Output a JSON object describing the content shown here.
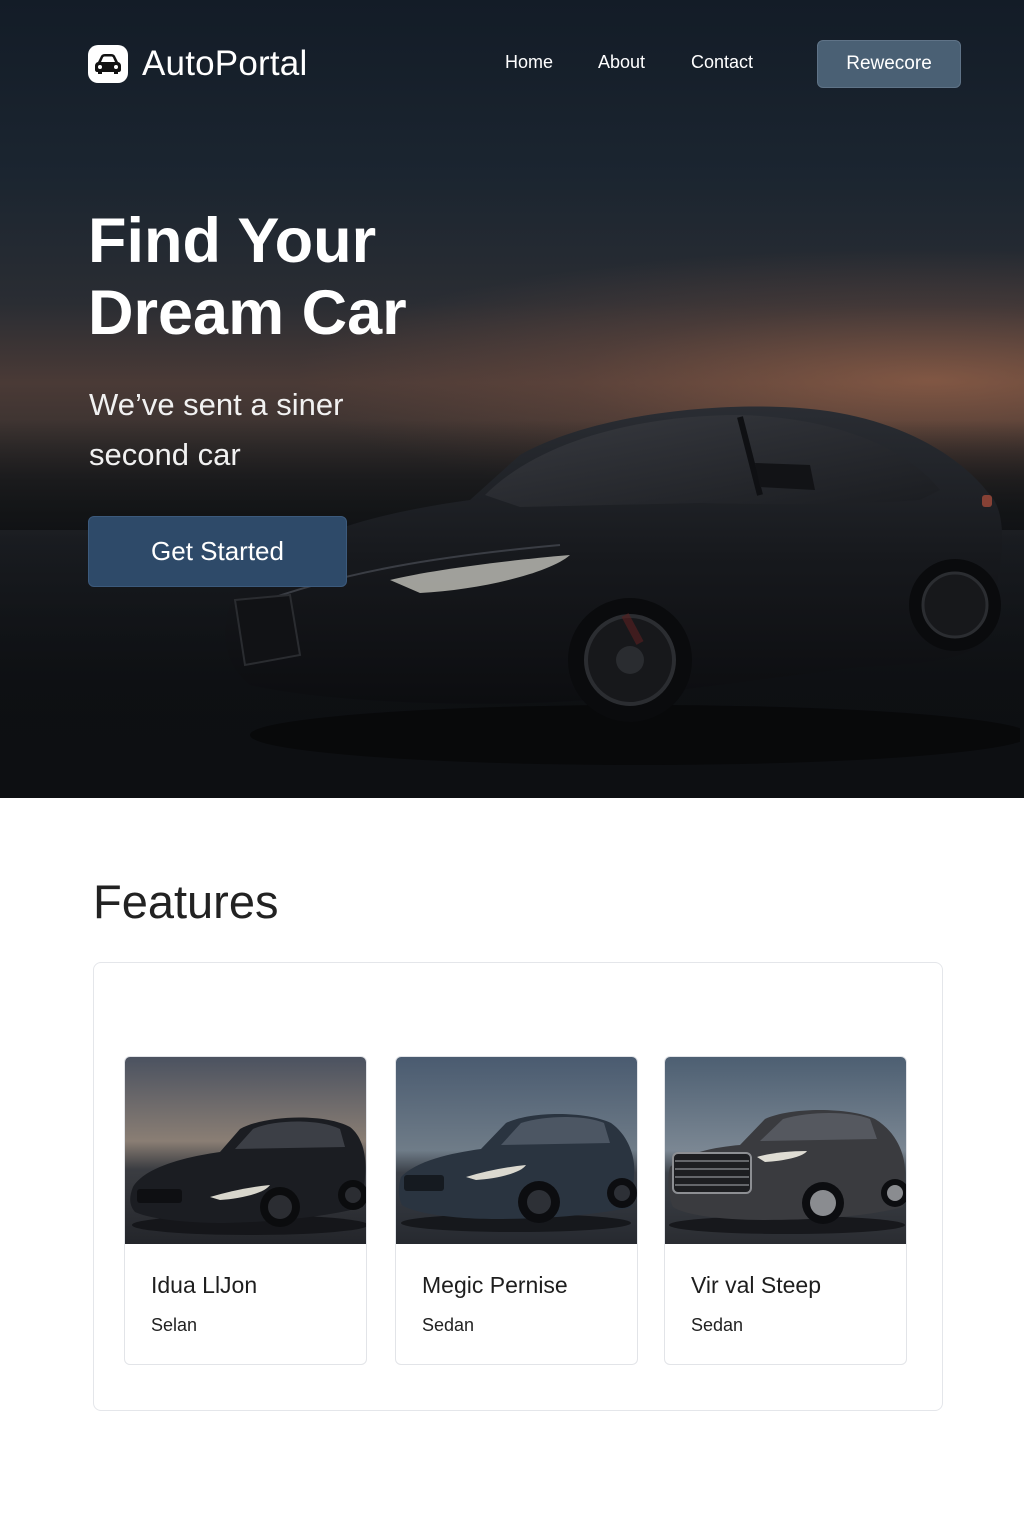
{
  "header": {
    "brand": "AutoPortal",
    "logo_icon": "car-icon",
    "nav": [
      "Home",
      "About",
      "Contact"
    ],
    "cta_label": "Rewecore"
  },
  "hero": {
    "title_line1": "Find Your",
    "title_line2": "Dream Car",
    "subtitle": "We’ve sent a siner second car",
    "button_label": "Get Started"
  },
  "features": {
    "title": "Features",
    "cards": [
      {
        "name": "Idua LlJon",
        "type": "Selan"
      },
      {
        "name": "Megic Pernise",
        "type": "Sedan"
      },
      {
        "name": "Vir val Steep",
        "type": "Sedan"
      }
    ]
  },
  "colors": {
    "hero_dark": "#131c27",
    "sunset_accent": "#c47a54",
    "primary_button": "#2e4a69",
    "nav_button": "#4a6074"
  }
}
